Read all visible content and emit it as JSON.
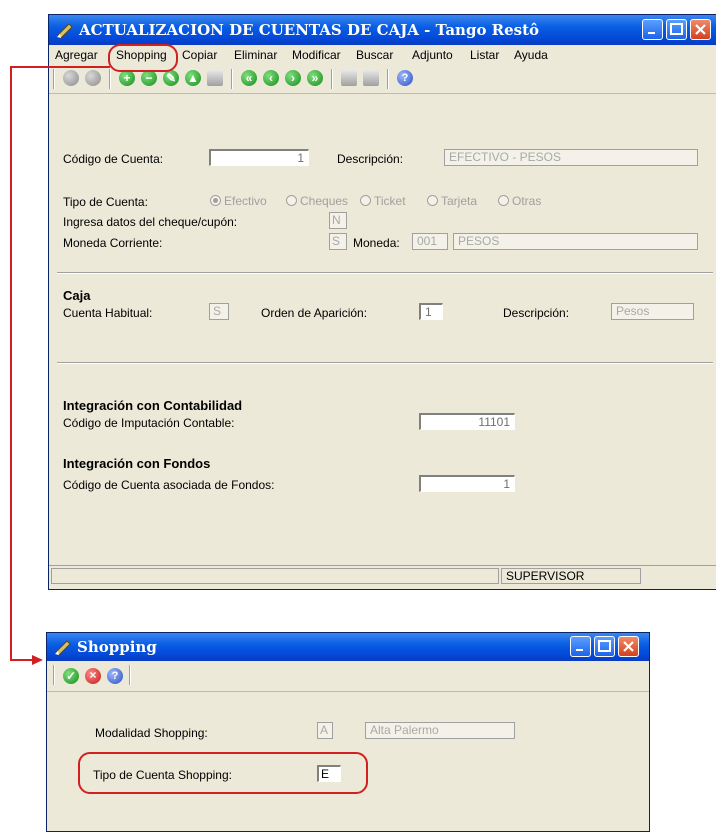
{
  "main_window": {
    "title": "ACTUALIZACION DE CUENTAS DE CAJA - Tango Restô",
    "menu": [
      {
        "label": "Agregar"
      },
      {
        "label": "Shopping"
      },
      {
        "label": "Copiar"
      },
      {
        "label": "Eliminar"
      },
      {
        "label": "Modificar"
      },
      {
        "label": "Buscar"
      },
      {
        "label": "Adjunto"
      },
      {
        "label": "Listar"
      },
      {
        "label": "Ayuda"
      }
    ],
    "form": {
      "codigo_label": "Código de Cuenta:",
      "codigo_value": "1",
      "descripcion_label": "Descripción:",
      "descripcion_value": "EFECTIVO - PESOS",
      "tipo_label": "Tipo de Cuenta:",
      "tipo_options": [
        "Efectivo",
        "Cheques",
        "Ticket",
        "Tarjeta",
        "Otras"
      ],
      "tipo_selected": "Efectivo",
      "ingresa_label": "Ingresa datos del cheque/cupón:",
      "ingresa_value": "N",
      "moneda_corriente_label": "Moneda Corriente:",
      "moneda_corriente_value": "S",
      "moneda_label": "Moneda:",
      "moneda_code": "001",
      "moneda_desc": "PESOS",
      "caja_heading": "Caja",
      "cuenta_habitual_label": "Cuenta Habitual:",
      "cuenta_habitual_value": "S",
      "orden_label": "Orden de Aparición:",
      "orden_value": "1",
      "caja_desc_label": "Descripción:",
      "caja_desc_value": "Pesos",
      "contab_heading": "Integración con Contabilidad",
      "imputacion_label": "Código de Imputación Contable:",
      "imputacion_value": "11101",
      "fondos_heading": "Integración con Fondos",
      "fondos_label": "Código de Cuenta asociada de Fondos:",
      "fondos_value": "1"
    },
    "status_user": "SUPERVISOR"
  },
  "shopping_window": {
    "title": "Shopping",
    "modalidad_label": "Modalidad Shopping:",
    "modalidad_code": "A",
    "modalidad_desc": "Alta Palermo",
    "tipo_label": "Tipo de Cuenta Shopping:",
    "tipo_value": "E"
  },
  "colors": {
    "titlebar": "#0a5ee4",
    "callout": "#d02020",
    "window_bg": "#ece9d8"
  }
}
